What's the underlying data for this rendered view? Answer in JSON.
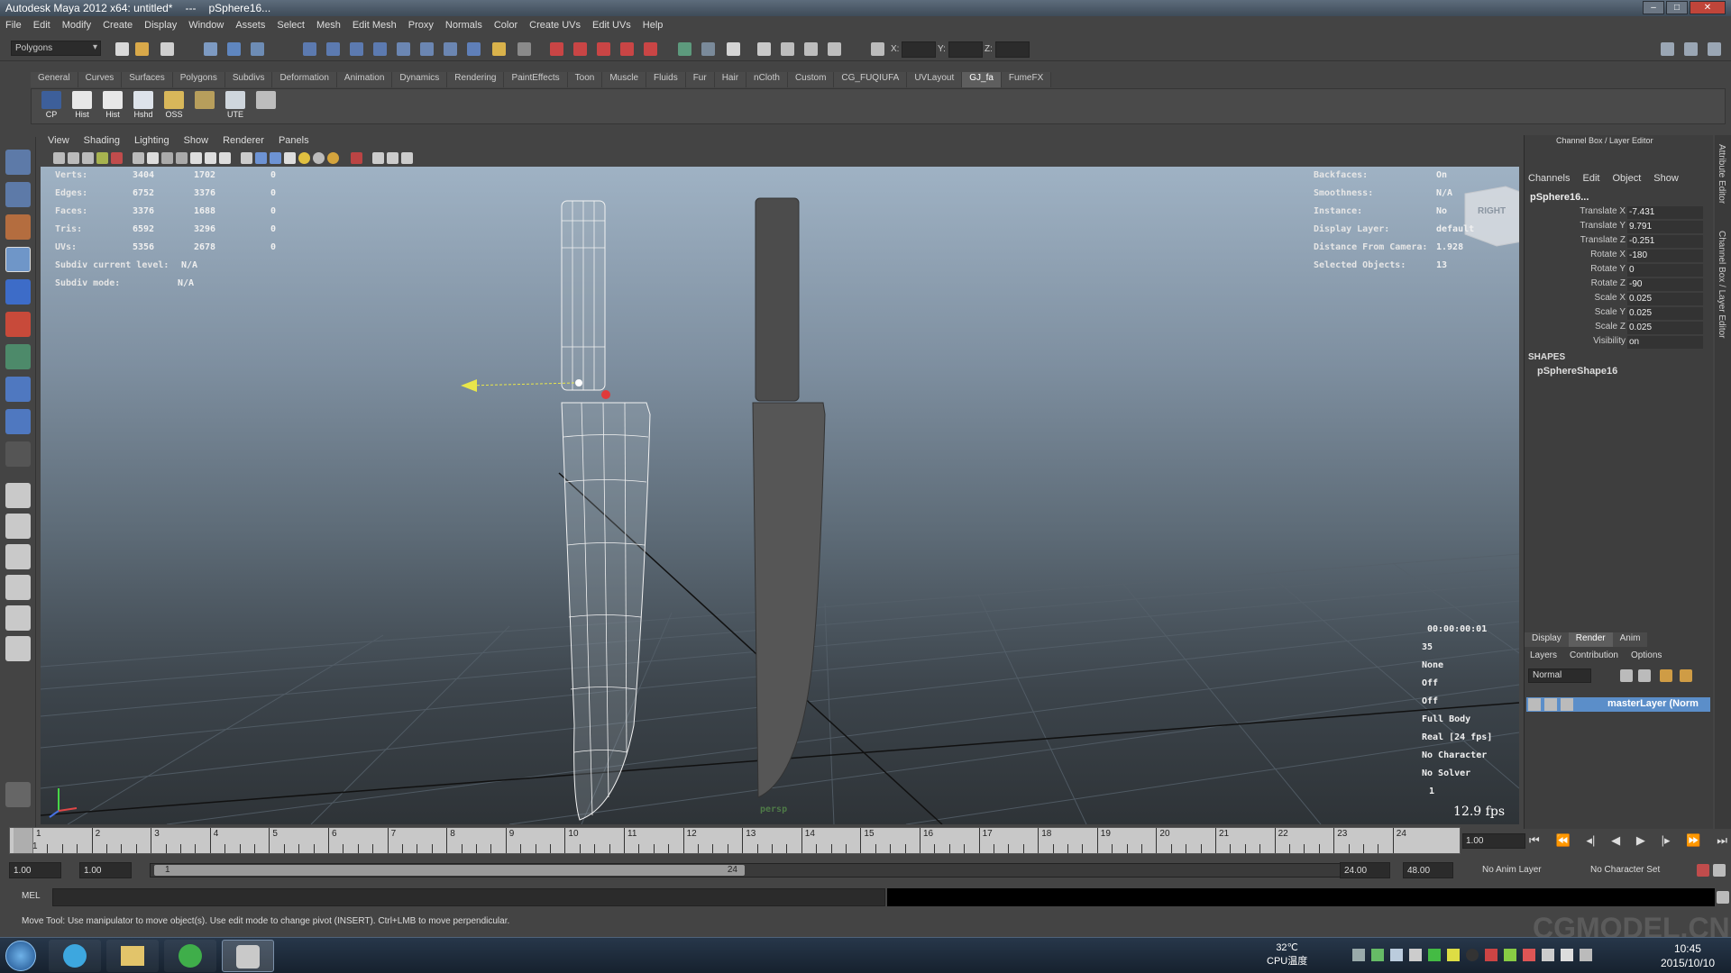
{
  "window": {
    "title": "Autodesk Maya 2012 x64: untitled*",
    "separator": "---",
    "object": "pSphere16..."
  },
  "menus": [
    "File",
    "Edit",
    "Modify",
    "Create",
    "Display",
    "Window",
    "Assets",
    "Select",
    "Mesh",
    "Edit Mesh",
    "Proxy",
    "Normals",
    "Color",
    "Create UVs",
    "Edit UVs",
    "Help"
  ],
  "statusline": {
    "menu_set": "Polygons",
    "x_label": "X:",
    "y_label": "Y:",
    "z_label": "Z:"
  },
  "shelf": {
    "tabs": [
      "General",
      "Curves",
      "Surfaces",
      "Polygons",
      "Subdivs",
      "Deformation",
      "Animation",
      "Dynamics",
      "Rendering",
      "PaintEffects",
      "Toon",
      "Muscle",
      "Fluids",
      "Fur",
      "Hair",
      "nCloth",
      "Custom",
      "CG_FUQIUFA",
      "UVLayout",
      "GJ_fa",
      "FumeFX"
    ],
    "active_tab": "GJ_fa",
    "buttons": [
      "CP",
      "Hist",
      "Hist",
      "Hshd",
      "OSS",
      "",
      "UTE",
      ""
    ]
  },
  "viewport": {
    "menus": [
      "View",
      "Shading",
      "Lighting",
      "Show",
      "Renderer",
      "Panels"
    ],
    "hud_left": [
      {
        "label": "Verts:",
        "a": "3404",
        "b": "1702",
        "c": "0"
      },
      {
        "label": "Edges:",
        "a": "6752",
        "b": "3376",
        "c": "0"
      },
      {
        "label": "Faces:",
        "a": "3376",
        "b": "1688",
        "c": "0"
      },
      {
        "label": "Tris:",
        "a": "6592",
        "b": "3296",
        "c": "0"
      },
      {
        "label": "UVs:",
        "a": "5356",
        "b": "2678",
        "c": "0"
      },
      {
        "label": "Subdiv current level:",
        "a": "N/A",
        "b": "",
        "c": ""
      },
      {
        "label": "Subdiv mode:",
        "a": "N/A",
        "b": "",
        "c": ""
      }
    ],
    "hud_right": [
      {
        "label": "Backfaces:",
        "value": "On"
      },
      {
        "label": "Smoothness:",
        "value": "N/A"
      },
      {
        "label": "Instance:",
        "value": "No"
      },
      {
        "label": "Display Layer:",
        "value": "default"
      },
      {
        "label": "Distance From Camera:",
        "value": "1.928"
      },
      {
        "label": "Selected Objects:",
        "value": "13"
      }
    ],
    "hud_bottom_values": [
      "00:00:00:01",
      "35",
      "None",
      "Off",
      "Off",
      "Full Body",
      "Real [24 fps]",
      "No Character",
      "No Solver",
      "1"
    ],
    "viewcube_label": "RIGHT",
    "camera": "persp",
    "fps": "12.9 fps"
  },
  "channel_box": {
    "header": "Channel Box / Layer Editor",
    "menus": [
      "Channels",
      "Edit",
      "Object",
      "Show"
    ],
    "object": "pSphere16...",
    "channels": [
      {
        "name": "Translate X",
        "value": "-7.431"
      },
      {
        "name": "Translate Y",
        "value": "9.791"
      },
      {
        "name": "Translate Z",
        "value": "-0.251"
      },
      {
        "name": "Rotate X",
        "value": "-180"
      },
      {
        "name": "Rotate Y",
        "value": "0"
      },
      {
        "name": "Rotate Z",
        "value": "-90"
      },
      {
        "name": "Scale X",
        "value": "0.025"
      },
      {
        "name": "Scale Y",
        "value": "0.025"
      },
      {
        "name": "Scale Z",
        "value": "0.025"
      },
      {
        "name": "Visibility",
        "value": "on"
      }
    ],
    "shapes_label": "SHAPES",
    "shape": "pSphereShape16"
  },
  "layer_editor": {
    "tabs": [
      "Display",
      "Render",
      "Anim"
    ],
    "active_tab": "Render",
    "menus": [
      "Layers",
      "Contribution",
      "Options"
    ],
    "blend_mode": "Normal",
    "layer": "masterLayer (Norm"
  },
  "side_tabs": [
    "Attribute Editor",
    "Channel Box / Layer Editor"
  ],
  "timeslider": {
    "ticks": [
      "1",
      "2",
      "3",
      "4",
      "5",
      "6",
      "7",
      "8",
      "9",
      "10",
      "11",
      "12",
      "13",
      "14",
      "15",
      "16",
      "17",
      "18",
      "19",
      "20",
      "21",
      "22",
      "23",
      "24"
    ],
    "current_frame_marker": "1",
    "current_frame": "1.00"
  },
  "range": {
    "start": "1.00",
    "playback_start": "1.00",
    "knob_start": "1",
    "knob_end": "24",
    "playback_end": "24.00",
    "end": "48.00",
    "anim_layer": "No Anim Layer",
    "char_set": "No Character Set"
  },
  "command": {
    "label": "MEL"
  },
  "help": "Move Tool: Use manipulator to move object(s). Use edit mode to change pivot (INSERT). Ctrl+LMB to move perpendicular.",
  "taskbar": {
    "temp": "32℃",
    "cpu": "CPU温度",
    "time": "10:45",
    "date": "2015/10/10"
  },
  "watermark": "CGMODEL.CN"
}
